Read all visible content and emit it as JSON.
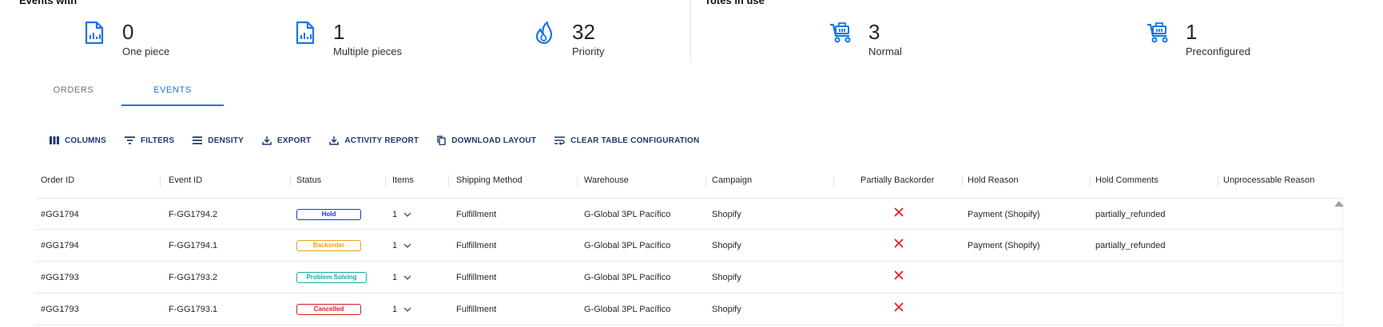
{
  "colors": {
    "accent": "#1a73e8",
    "toolbar": "#1d3a6e",
    "hold": "#1a2fd6",
    "backorder": "#e6a21a",
    "problem_solving": "#1aa7a7",
    "cancelled": "#d62020",
    "x_mark": "#e3201b"
  },
  "sections": {
    "events_title": "Events with",
    "totes_title": "Totes in use"
  },
  "stats": [
    {
      "icon": "report-icon",
      "value": "0",
      "label": "One piece"
    },
    {
      "icon": "report-icon",
      "value": "1",
      "label": "Multiple pieces"
    },
    {
      "icon": "flame-icon",
      "value": "32",
      "label": "Priority"
    },
    {
      "icon": "tote-cart-icon",
      "value": "3",
      "label": "Normal"
    },
    {
      "icon": "tote-cart-icon",
      "value": "1",
      "label": "Preconfigured"
    }
  ],
  "tabs": [
    {
      "label": "ORDERS",
      "active": false
    },
    {
      "label": "EVENTS",
      "active": true
    }
  ],
  "toolbar": [
    {
      "icon": "columns-icon",
      "label": "COLUMNS"
    },
    {
      "icon": "filter-icon",
      "label": "FILTERS"
    },
    {
      "icon": "density-icon",
      "label": "DENSITY"
    },
    {
      "icon": "export-icon",
      "label": "EXPORT"
    },
    {
      "icon": "download-icon",
      "label": "ACTIVITY REPORT"
    },
    {
      "icon": "copy-icon",
      "label": "DOWNLOAD LAYOUT"
    },
    {
      "icon": "wrap-icon",
      "label": "CLEAR TABLE CONFIGURATION"
    }
  ],
  "table": {
    "columns": [
      "Order ID",
      "Event ID",
      "Status",
      "Items",
      "Shipping Method",
      "Warehouse",
      "Campaign",
      "Partially Backorder",
      "Hold Reason",
      "Hold Comments",
      "Unprocessable Reason"
    ],
    "rows": [
      {
        "order_id": "#GG1794",
        "event_id": "F-GG1794.2",
        "status": "Hold",
        "items": "1",
        "shipping": "Fulfillment",
        "warehouse": "G-Global 3PL Pacífico",
        "campaign": "Shopify",
        "hold_reason": "Payment (Shopify)",
        "hold_comments": "partially_refunded"
      },
      {
        "order_id": "#GG1794",
        "event_id": "F-GG1794.1",
        "status": "Backorder",
        "items": "1",
        "shipping": "Fulfillment",
        "warehouse": "G-Global 3PL Pacífico",
        "campaign": "Shopify",
        "hold_reason": "Payment (Shopify)",
        "hold_comments": "partially_refunded"
      },
      {
        "order_id": "#GG1793",
        "event_id": "F-GG1793.2",
        "status": "Problem Solving",
        "items": "1",
        "shipping": "Fulfillment",
        "warehouse": "G-Global 3PL Pacífico",
        "campaign": "Shopify",
        "hold_reason": "",
        "hold_comments": ""
      },
      {
        "order_id": "#GG1793",
        "event_id": "F-GG1793.1",
        "status": "Cancelled",
        "items": "1",
        "shipping": "Fulfillment",
        "warehouse": "G-Global 3PL Pacífico",
        "campaign": "Shopify",
        "hold_reason": "",
        "hold_comments": ""
      }
    ]
  }
}
